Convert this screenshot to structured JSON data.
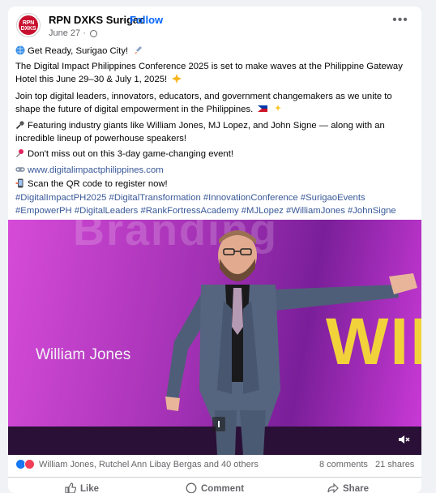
{
  "post": {
    "page_name": "RPN DXKS Surigao",
    "follow_label": "Follow",
    "date": "June 27",
    "avatar_text": "RPN DXKS",
    "lines": {
      "l1": "Get Ready, Surigao City!",
      "l2": "The Digital Impact Philippines Conference 2025 is set to make waves at the Philippine Gateway Hotel this June 29–30 & July 1, 2025!",
      "l3": "Join top digital leaders, innovators, educators, and government changemakers as we unite to shape the future of digital empowerment in the Philippines.",
      "l4": "Featuring industry giants like William Jones, MJ Lopez, and John Signe — along with an incredible lineup of powerhouse speakers!",
      "l5": "Don't miss out on this 3-day game-changing event!",
      "link": "www.digitalimpactphilippines.com",
      "qr": "Scan the QR code to register now!"
    },
    "hashtags": "#DigitalImpactPH2025 #DigitalTransformation #InnovationConference #SurigaoEvents #EmpowerPH #DigitalLeaders #RankFortressAcademy #MJLopez #WilliamJones #JohnSigne"
  },
  "video": {
    "speaker_label": "William Jones",
    "big_text": "WILL",
    "bg_word": "Branding"
  },
  "engagement": {
    "reactions_text": "William Jones, Rutchel Ann Libay Bergas and 40 others",
    "comments": "8 comments",
    "shares": "21 shares"
  },
  "actions": {
    "like": "Like",
    "comment": "Comment",
    "share": "Share"
  },
  "colors": {
    "link": "#385898",
    "follow": "#0866ff",
    "like_react": "#1877f2",
    "love_react": "#f33e58",
    "accent_title": "#f2d23a"
  }
}
